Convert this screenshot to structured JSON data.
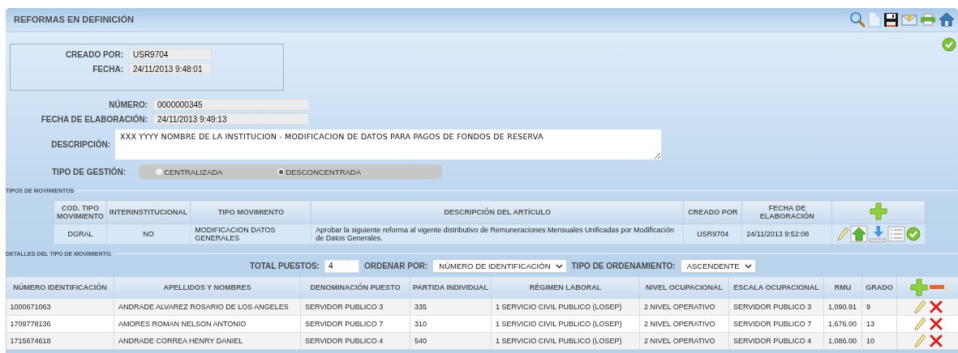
{
  "header": {
    "title": "REFORMAS EN DEFINICIÓN"
  },
  "creation": {
    "fields": [
      {
        "label": "CREADO POR:",
        "value": "USR9704"
      },
      {
        "label": "FECHA:",
        "value": "24/11/2013 9:48:01"
      }
    ]
  },
  "form": {
    "fields": [
      {
        "label": "NÚMERO:",
        "value": "0000000345"
      },
      {
        "label": "FECHA DE ELABORACIÓN:",
        "value": "24/11/2013 9:49:13"
      }
    ],
    "description": {
      "label": "DESCRIPCIÓN:",
      "value": "XXX YYYY NOMBRE DE LA INSTITUCION - MODIFICACION DE DATOS PARA PAGOS DE FONDOS DE RESERVA"
    },
    "management_type": {
      "label": "TIPO DE GESTIÓN:",
      "options": [
        {
          "label": "CENTRALIZADA",
          "selected": false
        },
        {
          "label": "DESCONCENTRADA",
          "selected": true
        }
      ]
    }
  },
  "movement_types": {
    "legend": "TIPOS DE MOVIMIENTOS",
    "columns": [
      "COD. TIPO MOVIMIENTO",
      "INTERINSTITUCIONAL",
      "TIPO MOVIMIENTO",
      "DESCRIPCIÓN DEL ARTÍCULO",
      "CREADO POR",
      "FECHA DE ELABORACIÓN"
    ],
    "rows": [
      [
        "DGRAL",
        "NO",
        "MODIFICACION DATOS GENERALES",
        "Aprobar la siguiente reforma al vigente distributivo de Remuneraciones Mensuales Unificadas por Modificación de Datos Generales.",
        "USR9704",
        "24/11/2013 9:52:08"
      ]
    ]
  },
  "movement_details": {
    "legend": "DETALLES DEL TIPO DE MOVIMIENTO.",
    "total": {
      "label": "TOTAL PUESTOS:",
      "value": "4"
    },
    "sort_by": {
      "label": "ORDENAR POR:",
      "value": "NÚMERO DE IDENTIFICACIÓN"
    },
    "sort_order": {
      "label": "TIPO DE ORDENAMIENTO:",
      "value": "ASCENDENTE"
    },
    "columns": [
      "NÚMERO IDENTIFICACIÓN",
      "APELLIDOS Y NOMBRES",
      "DENOMINACIÓN PUESTO",
      "PARTIDA INDIVIDUAL",
      "RÉGIMEN LABORAL",
      "NIVEL OCUPACIONAL",
      "ESCALA OCUPACIONAL",
      "RMU",
      "GRADO"
    ],
    "rows": [
      [
        "1000671063",
        "ANDRADE ALVAREZ ROSARIO DE LOS ANGELES",
        "SERVIDOR PUBLICO 3",
        "335",
        "1 SERVICIO CIVIL PUBLICO (LOSEP)",
        "2 NIVEL OPERATIVO",
        "SERVIDOR PUBLICO 3",
        "1,090.91",
        "9"
      ],
      [
        "1709778136",
        "AMORES ROMAN NELSON ANTONIO",
        "SERVIDOR PUBLICO 7",
        "310",
        "1 SERVICIO CIVIL PUBLICO (LOSEP)",
        "2 NIVEL OPERATIVO",
        "SERVIDOR PUBLICO 7",
        "1,676.00",
        "13"
      ],
      [
        "1715674618",
        "ANDRADE CORREA HENRY DANIEL",
        "SERVIDOR PUBLICO 4",
        "540",
        "1 SERVICIO CIVIL PUBLICO (LOSEP)",
        "2 NIVEL OPERATIVO",
        "SERVIDOR PUBLICO 4",
        "1,086.00",
        "10"
      ]
    ]
  }
}
